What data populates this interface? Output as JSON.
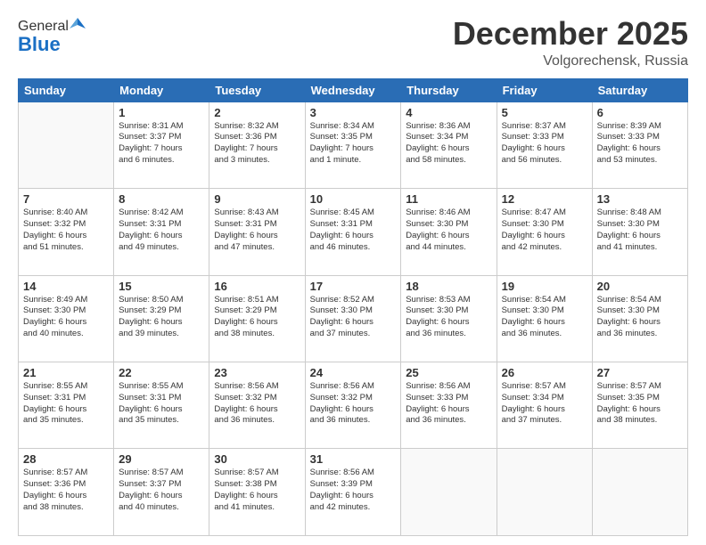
{
  "header": {
    "logo_general": "General",
    "logo_blue": "Blue",
    "month_title": "December 2025",
    "location": "Volgorechensk, Russia"
  },
  "days_of_week": [
    "Sunday",
    "Monday",
    "Tuesday",
    "Wednesday",
    "Thursday",
    "Friday",
    "Saturday"
  ],
  "weeks": [
    [
      {
        "day": "",
        "info": ""
      },
      {
        "day": "1",
        "info": "Sunrise: 8:31 AM\nSunset: 3:37 PM\nDaylight: 7 hours\nand 6 minutes."
      },
      {
        "day": "2",
        "info": "Sunrise: 8:32 AM\nSunset: 3:36 PM\nDaylight: 7 hours\nand 3 minutes."
      },
      {
        "day": "3",
        "info": "Sunrise: 8:34 AM\nSunset: 3:35 PM\nDaylight: 7 hours\nand 1 minute."
      },
      {
        "day": "4",
        "info": "Sunrise: 8:36 AM\nSunset: 3:34 PM\nDaylight: 6 hours\nand 58 minutes."
      },
      {
        "day": "5",
        "info": "Sunrise: 8:37 AM\nSunset: 3:33 PM\nDaylight: 6 hours\nand 56 minutes."
      },
      {
        "day": "6",
        "info": "Sunrise: 8:39 AM\nSunset: 3:33 PM\nDaylight: 6 hours\nand 53 minutes."
      }
    ],
    [
      {
        "day": "7",
        "info": "Sunrise: 8:40 AM\nSunset: 3:32 PM\nDaylight: 6 hours\nand 51 minutes."
      },
      {
        "day": "8",
        "info": "Sunrise: 8:42 AM\nSunset: 3:31 PM\nDaylight: 6 hours\nand 49 minutes."
      },
      {
        "day": "9",
        "info": "Sunrise: 8:43 AM\nSunset: 3:31 PM\nDaylight: 6 hours\nand 47 minutes."
      },
      {
        "day": "10",
        "info": "Sunrise: 8:45 AM\nSunset: 3:31 PM\nDaylight: 6 hours\nand 46 minutes."
      },
      {
        "day": "11",
        "info": "Sunrise: 8:46 AM\nSunset: 3:30 PM\nDaylight: 6 hours\nand 44 minutes."
      },
      {
        "day": "12",
        "info": "Sunrise: 8:47 AM\nSunset: 3:30 PM\nDaylight: 6 hours\nand 42 minutes."
      },
      {
        "day": "13",
        "info": "Sunrise: 8:48 AM\nSunset: 3:30 PM\nDaylight: 6 hours\nand 41 minutes."
      }
    ],
    [
      {
        "day": "14",
        "info": "Sunrise: 8:49 AM\nSunset: 3:30 PM\nDaylight: 6 hours\nand 40 minutes."
      },
      {
        "day": "15",
        "info": "Sunrise: 8:50 AM\nSunset: 3:29 PM\nDaylight: 6 hours\nand 39 minutes."
      },
      {
        "day": "16",
        "info": "Sunrise: 8:51 AM\nSunset: 3:29 PM\nDaylight: 6 hours\nand 38 minutes."
      },
      {
        "day": "17",
        "info": "Sunrise: 8:52 AM\nSunset: 3:30 PM\nDaylight: 6 hours\nand 37 minutes."
      },
      {
        "day": "18",
        "info": "Sunrise: 8:53 AM\nSunset: 3:30 PM\nDaylight: 6 hours\nand 36 minutes."
      },
      {
        "day": "19",
        "info": "Sunrise: 8:54 AM\nSunset: 3:30 PM\nDaylight: 6 hours\nand 36 minutes."
      },
      {
        "day": "20",
        "info": "Sunrise: 8:54 AM\nSunset: 3:30 PM\nDaylight: 6 hours\nand 36 minutes."
      }
    ],
    [
      {
        "day": "21",
        "info": "Sunrise: 8:55 AM\nSunset: 3:31 PM\nDaylight: 6 hours\nand 35 minutes."
      },
      {
        "day": "22",
        "info": "Sunrise: 8:55 AM\nSunset: 3:31 PM\nDaylight: 6 hours\nand 35 minutes."
      },
      {
        "day": "23",
        "info": "Sunrise: 8:56 AM\nSunset: 3:32 PM\nDaylight: 6 hours\nand 36 minutes."
      },
      {
        "day": "24",
        "info": "Sunrise: 8:56 AM\nSunset: 3:32 PM\nDaylight: 6 hours\nand 36 minutes."
      },
      {
        "day": "25",
        "info": "Sunrise: 8:56 AM\nSunset: 3:33 PM\nDaylight: 6 hours\nand 36 minutes."
      },
      {
        "day": "26",
        "info": "Sunrise: 8:57 AM\nSunset: 3:34 PM\nDaylight: 6 hours\nand 37 minutes."
      },
      {
        "day": "27",
        "info": "Sunrise: 8:57 AM\nSunset: 3:35 PM\nDaylight: 6 hours\nand 38 minutes."
      }
    ],
    [
      {
        "day": "28",
        "info": "Sunrise: 8:57 AM\nSunset: 3:36 PM\nDaylight: 6 hours\nand 38 minutes."
      },
      {
        "day": "29",
        "info": "Sunrise: 8:57 AM\nSunset: 3:37 PM\nDaylight: 6 hours\nand 40 minutes."
      },
      {
        "day": "30",
        "info": "Sunrise: 8:57 AM\nSunset: 3:38 PM\nDaylight: 6 hours\nand 41 minutes."
      },
      {
        "day": "31",
        "info": "Sunrise: 8:56 AM\nSunset: 3:39 PM\nDaylight: 6 hours\nand 42 minutes."
      },
      {
        "day": "",
        "info": ""
      },
      {
        "day": "",
        "info": ""
      },
      {
        "day": "",
        "info": ""
      }
    ]
  ]
}
